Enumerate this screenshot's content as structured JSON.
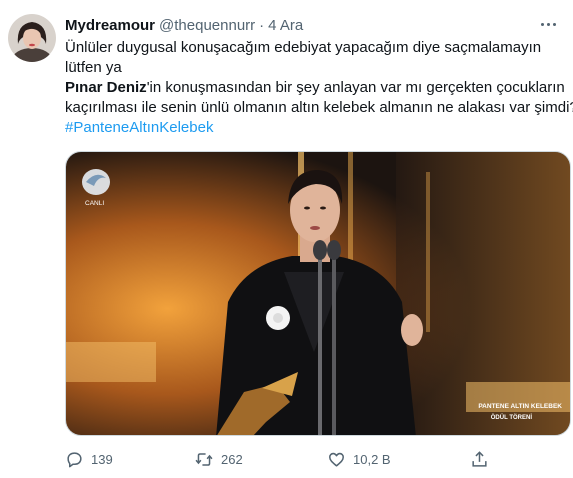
{
  "tweet": {
    "author": {
      "display_name": "Mydreamour",
      "handle": "@thequennurr",
      "separator": "·",
      "date": "4 Ara",
      "avatar_icon": "profile-avatar"
    },
    "text": {
      "line1": "Ünlüler duygusal konuşacağım edebiyat yapacağım diye saçmalamayın",
      "line2": "lütfen ya",
      "mention_bold": "Pınar Deniz",
      "line3_rest": "'in konuşmasından bir şey anlayan var mı gerçekten çocukların",
      "line4": "kaçırılması ile senin ünlü olmanın altın kelebek almanın ne alakası var şimdi?",
      "hashtag": "#PanteneAltınKelebek"
    },
    "media": {
      "channel_logo_text": "CANLI",
      "caption_line1": "PANTENE ALTIN KELEBEK",
      "caption_line2": "ÖDÜL TÖRENİ"
    },
    "actions": {
      "reply_count": "139",
      "retweet_count": "262",
      "like_count": "10,2 B",
      "reply_icon": "reply-icon",
      "retweet_icon": "retweet-icon",
      "like_icon": "heart-icon",
      "share_icon": "share-icon",
      "more_icon": "more-options-icon"
    },
    "colors": {
      "text": "#0f1419",
      "secondary": "#536471",
      "link": "#1d9bf0",
      "border": "#cfd9de"
    }
  }
}
